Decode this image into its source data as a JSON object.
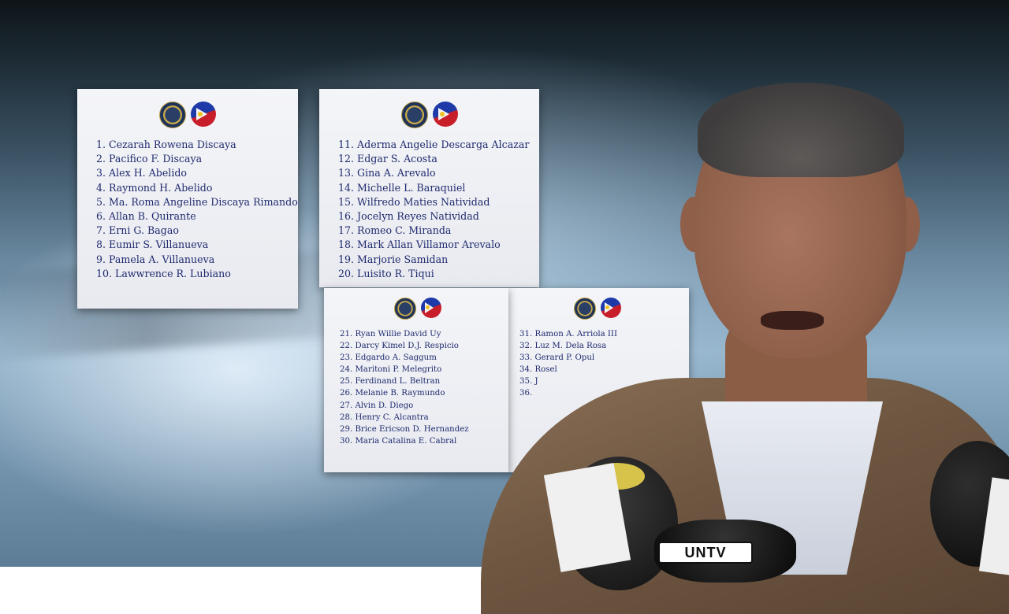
{
  "panels": [
    {
      "id": "panel-1",
      "names": [
        "1. Cezarah Rowena Discaya",
        "2. Pacifico F. Discaya",
        "3. Alex H. Abelido",
        "4. Raymond H. Abelido",
        "5. Ma. Roma Angeline Discaya Rimando",
        "6. Allan B. Quirante",
        "7. Erni G. Bagao",
        "8. Eumir S. Villanueva",
        "9. Pamela A. Villanueva",
        "10. Lawwrence R. Lubiano"
      ]
    },
    {
      "id": "panel-2",
      "names": [
        "11. Aderma Angelie Descarga Alcazar",
        "12. Edgar S. Acosta",
        "13. Gina A. Arevalo",
        "14. Michelle L. Baraquiel",
        "15. Wilfredo Maties Natividad",
        "16. Jocelyn Reyes Natividad",
        "17. Romeo C. Miranda",
        "18. Mark Allan Villamor Arevalo",
        "19. Marjorie Samidan",
        "20. Luisito R. Tiqui"
      ]
    },
    {
      "id": "panel-3",
      "names": [
        "21. Ryan Willie David Uy",
        "22. Darcy Kimel D.J. Respicio",
        "23. Edgardo A. Saggum",
        "24. Maritoni P. Melegrito",
        "25. Ferdinand L. Beltran",
        "26. Melanie B. Raymundo",
        "27. Alvin D. Diego",
        "28. Henry C. Alcantra",
        "29. Brice Ericson D. Hernandez",
        "30. Maria Catalina E. Cabral"
      ]
    },
    {
      "id": "panel-4",
      "names": [
        "31. Ramon A. Arriola III",
        "32. Luz M. Dela Rosa",
        "33. Gerard P. Opul",
        "34. Rosel",
        "35. J",
        "36."
      ]
    }
  ],
  "microphone_label": "UNTV",
  "seal_icons": [
    "doj-seal-icon",
    "philippine-flag-seal-icon"
  ]
}
